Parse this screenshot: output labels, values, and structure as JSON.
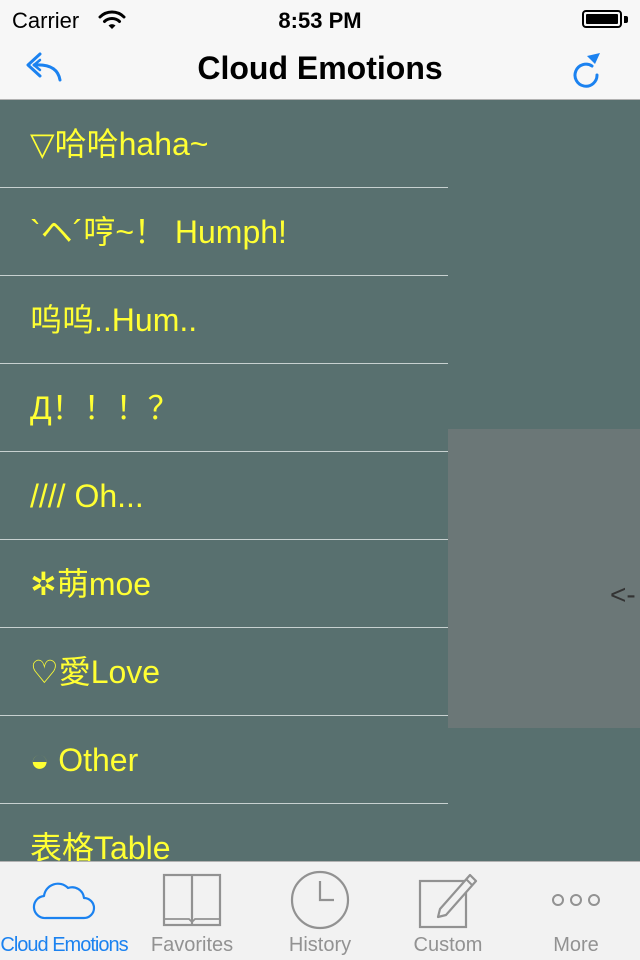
{
  "status_bar": {
    "carrier": "Carrier",
    "time": "8:53 PM",
    "wifi_icon": "wifi-icon",
    "battery_icon": "battery-icon"
  },
  "nav": {
    "title": "Cloud Emotions",
    "back_icon": "reply-arrow-icon",
    "refresh_icon": "refresh-icon",
    "accent_color": "#1b82f0"
  },
  "emotion_list": {
    "text_color": "#ffff33",
    "items": [
      {
        "label": "▽哈哈haha~"
      },
      {
        "label": "`ヘ´哼~！ Humph!"
      },
      {
        "label": "呜呜..Hum.."
      },
      {
        "label": "Д！！！？"
      },
      {
        "label": "//// Oh..."
      },
      {
        "label": "✲萌moe"
      },
      {
        "label": "♡愛Love"
      },
      {
        "label": "◒ Other"
      },
      {
        "label": "表格Table"
      }
    ]
  },
  "side_panel": {
    "arrow_text": "<-"
  },
  "tab_bar": {
    "active_color": "#1b82f0",
    "inactive_color": "#929292",
    "tabs": [
      {
        "label": "Cloud Emotions",
        "icon": "cloud-icon",
        "active": true
      },
      {
        "label": "Favorites",
        "icon": "book-icon",
        "active": false
      },
      {
        "label": "History",
        "icon": "clock-icon",
        "active": false
      },
      {
        "label": "Custom",
        "icon": "pencil-icon",
        "active": false
      },
      {
        "label": "More",
        "icon": "more-dots-icon",
        "active": false
      }
    ]
  }
}
